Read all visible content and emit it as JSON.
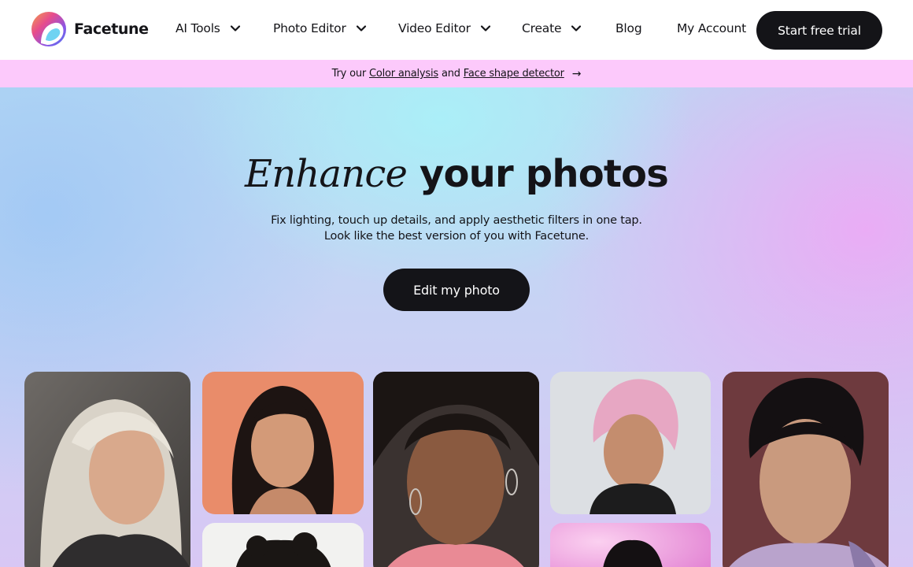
{
  "nav": {
    "brand": "Facetune",
    "items": [
      {
        "label": "AI Tools"
      },
      {
        "label": "Photo Editor"
      },
      {
        "label": "Video Editor"
      },
      {
        "label": "Create"
      }
    ],
    "blog": "Blog",
    "account": "My Account",
    "cta": "Start free trial"
  },
  "banner": {
    "prefix": "Try our",
    "link1": "Color analysis",
    "middle": "and",
    "link2": "Face shape detector",
    "arrow": "→"
  },
  "hero": {
    "title_italic": "Enhance",
    "title_rest": "your photos",
    "subtitle_line1": "Fix lighting, touch up details, and apply aesthetic filters in one tap.",
    "subtitle_line2": "Look like the best version of you with Facetune.",
    "button": "Edit my photo"
  },
  "icons": {
    "logo": "facetune-logo-icon",
    "chevron": "chevron-down-icon",
    "arrow": "arrow-right-icon"
  },
  "colors": {
    "primary_dark": "#141418",
    "banner_bg": "#fcc9fb"
  }
}
